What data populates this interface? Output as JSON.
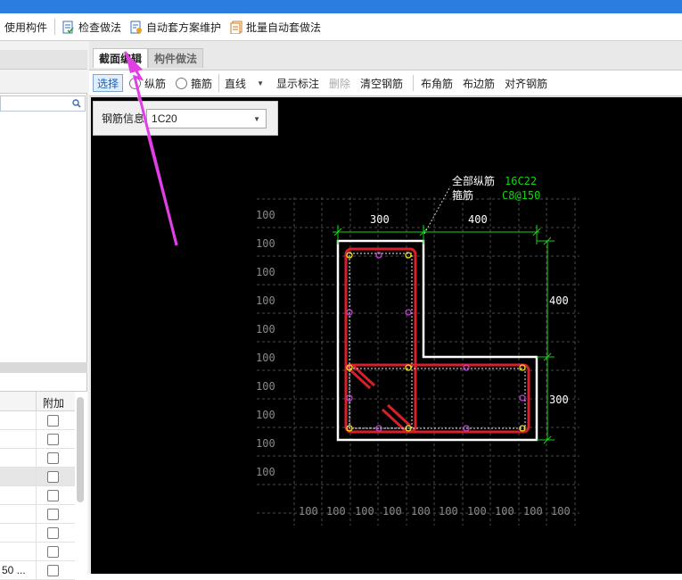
{
  "toolbar": {
    "items": [
      {
        "label": "使用构件",
        "icon": "component-icon"
      },
      {
        "label": "检查做法",
        "icon": "check-doc-icon"
      },
      {
        "label": "自动套方案维护",
        "icon": "auto-plan-icon"
      },
      {
        "label": "批量自动套做法",
        "icon": "batch-auto-icon"
      }
    ]
  },
  "left_panel": {
    "table_header": "附加",
    "row_text_last": "50 ..."
  },
  "tabs": [
    {
      "label": "截面编辑",
      "active": true
    },
    {
      "label": "构件做法",
      "active": false
    }
  ],
  "section_toolbar": {
    "select": "选择",
    "longitudinal": "纵筋",
    "stirrup": "箍筋",
    "line_type": "直线",
    "show_labels": "显示标注",
    "delete": "删除",
    "clear_rebar": "清空钢筋",
    "corner_rebar": "布角筋",
    "edge_rebar": "布边筋",
    "align_rebar": "对齐钢筋"
  },
  "rebar_info": {
    "label": "钢筋信息",
    "value": "1C20"
  },
  "drawing": {
    "all_longitudinal_label": "全部纵筋",
    "all_longitudinal_value": "16C22",
    "stirrup_label": "箍筋",
    "stirrup_value": "C8@150",
    "dim_top_left": "300",
    "dim_top_right": "400",
    "dim_right_upper": "400",
    "dim_right_lower": "300",
    "grid_label": "100",
    "colors": {
      "outline": "#ffffff",
      "rebar": "#d8202a",
      "dim": "#18d018",
      "text_green": "#18d018",
      "annotation_pointer": "#e23ee6"
    }
  }
}
